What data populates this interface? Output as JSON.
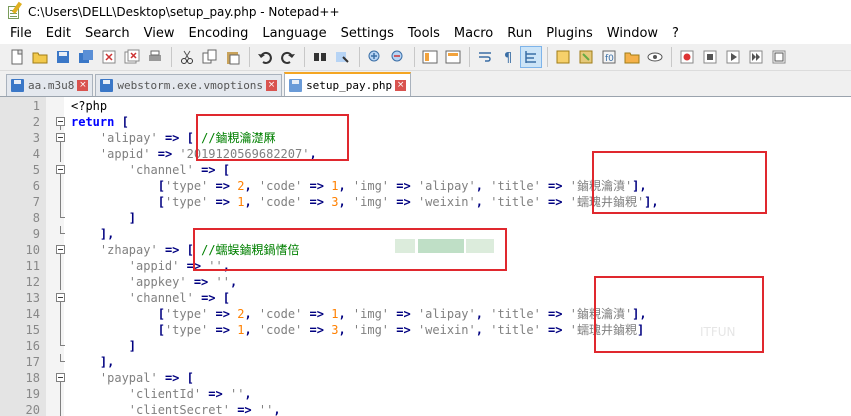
{
  "window": {
    "title": "C:\\Users\\DELL\\Desktop\\setup_pay.php - Notepad++",
    "app_icon": "notepad-plus-plus-icon"
  },
  "menu": [
    "File",
    "Edit",
    "Search",
    "View",
    "Encoding",
    "Language",
    "Settings",
    "Tools",
    "Macro",
    "Run",
    "Plugins",
    "Window",
    "?"
  ],
  "toolbar": {
    "buttons": [
      "new-file-icon",
      "open-file-icon",
      "save-icon",
      "save-all-icon",
      "close-icon",
      "close-all-icon",
      "print-icon",
      "cut-icon",
      "copy-icon",
      "paste-icon",
      "undo-icon",
      "redo-icon",
      "find-icon",
      "replace-icon",
      "zoom-in-icon",
      "zoom-out-icon",
      "sync-vertical-icon",
      "sync-horizontal-icon",
      "word-wrap-icon",
      "show-all-chars-icon",
      "indent-guide-icon",
      "user-lang-icon",
      "doc-map-icon",
      "function-list-icon",
      "folder-workspace-icon",
      "monitor-icon",
      "record-macro-icon",
      "stop-record-icon",
      "play-macro-icon",
      "run-macro-multiple-icon",
      "save-macro-icon"
    ]
  },
  "tabs": [
    {
      "label": "aa.m3u8",
      "active": false
    },
    {
      "label": "webstorm.exe.vmoptions",
      "active": false
    },
    {
      "label": "setup_pay.php",
      "active": true
    }
  ],
  "editor": {
    "lines": [
      {
        "n": "1",
        "fold": "",
        "tokens": [
          {
            "t": "php",
            "v": "<?php"
          }
        ]
      },
      {
        "n": "2",
        "fold": "box",
        "tokens": [
          {
            "t": "kw",
            "v": "return"
          },
          {
            "t": "php",
            "v": " "
          },
          {
            "t": "op",
            "v": "["
          }
        ]
      },
      {
        "n": "3",
        "fold": "box",
        "tokens": [
          {
            "t": "php",
            "v": "    "
          },
          {
            "t": "str",
            "v": "'alipay'"
          },
          {
            "t": "php",
            "v": " "
          },
          {
            "t": "op",
            "v": "=>"
          },
          {
            "t": "php",
            "v": " "
          },
          {
            "t": "op",
            "v": "["
          },
          {
            "t": "php",
            "v": " "
          },
          {
            "t": "cmt",
            "v": "//鏀粯瀹濋厤"
          }
        ]
      },
      {
        "n": "4",
        "fold": "line",
        "tokens": [
          {
            "t": "php",
            "v": "    "
          },
          {
            "t": "str",
            "v": "'appid'"
          },
          {
            "t": "php",
            "v": " "
          },
          {
            "t": "op",
            "v": "=>"
          },
          {
            "t": "php",
            "v": " "
          },
          {
            "t": "str",
            "v": "'2019120569682207'"
          },
          {
            "t": "op",
            "v": ","
          }
        ]
      },
      {
        "n": "5",
        "fold": "box",
        "tokens": [
          {
            "t": "php",
            "v": "        "
          },
          {
            "t": "str",
            "v": "'channel'"
          },
          {
            "t": "php",
            "v": " "
          },
          {
            "t": "op",
            "v": "=>"
          },
          {
            "t": "php",
            "v": " "
          },
          {
            "t": "op",
            "v": "["
          }
        ]
      },
      {
        "n": "6",
        "fold": "line",
        "tokens": [
          {
            "t": "php",
            "v": "            "
          },
          {
            "t": "op",
            "v": "["
          },
          {
            "t": "str",
            "v": "'type'"
          },
          {
            "t": "php",
            "v": " "
          },
          {
            "t": "op",
            "v": "=>"
          },
          {
            "t": "php",
            "v": " "
          },
          {
            "t": "num",
            "v": "2"
          },
          {
            "t": "op",
            "v": ","
          },
          {
            "t": "php",
            "v": " "
          },
          {
            "t": "str",
            "v": "'code'"
          },
          {
            "t": "php",
            "v": " "
          },
          {
            "t": "op",
            "v": "=>"
          },
          {
            "t": "php",
            "v": " "
          },
          {
            "t": "num",
            "v": "1"
          },
          {
            "t": "op",
            "v": ","
          },
          {
            "t": "php",
            "v": " "
          },
          {
            "t": "str",
            "v": "'img'"
          },
          {
            "t": "php",
            "v": " "
          },
          {
            "t": "op",
            "v": "=>"
          },
          {
            "t": "php",
            "v": " "
          },
          {
            "t": "str",
            "v": "'alipay'"
          },
          {
            "t": "op",
            "v": ","
          },
          {
            "t": "php",
            "v": " "
          },
          {
            "t": "str",
            "v": "'title'"
          },
          {
            "t": "php",
            "v": " "
          },
          {
            "t": "op",
            "v": "=>"
          },
          {
            "t": "php",
            "v": " "
          },
          {
            "t": "str",
            "v": "'鏀粯瀹濆'"
          },
          {
            "t": "op",
            "v": "],"
          }
        ]
      },
      {
        "n": "7",
        "fold": "line",
        "tokens": [
          {
            "t": "php",
            "v": "            "
          },
          {
            "t": "op",
            "v": "["
          },
          {
            "t": "str",
            "v": "'type'"
          },
          {
            "t": "php",
            "v": " "
          },
          {
            "t": "op",
            "v": "=>"
          },
          {
            "t": "php",
            "v": " "
          },
          {
            "t": "num",
            "v": "1"
          },
          {
            "t": "op",
            "v": ","
          },
          {
            "t": "php",
            "v": " "
          },
          {
            "t": "str",
            "v": "'code'"
          },
          {
            "t": "php",
            "v": " "
          },
          {
            "t": "op",
            "v": "=>"
          },
          {
            "t": "php",
            "v": " "
          },
          {
            "t": "num",
            "v": "3"
          },
          {
            "t": "op",
            "v": ","
          },
          {
            "t": "php",
            "v": " "
          },
          {
            "t": "str",
            "v": "'img'"
          },
          {
            "t": "php",
            "v": " "
          },
          {
            "t": "op",
            "v": "=>"
          },
          {
            "t": "php",
            "v": " "
          },
          {
            "t": "str",
            "v": "'weixin'"
          },
          {
            "t": "op",
            "v": ","
          },
          {
            "t": "php",
            "v": " "
          },
          {
            "t": "str",
            "v": "'title'"
          },
          {
            "t": "php",
            "v": " "
          },
          {
            "t": "op",
            "v": "=>"
          },
          {
            "t": "php",
            "v": " "
          },
          {
            "t": "str",
            "v": "'蠕瑰井鏀粯'"
          },
          {
            "t": "op",
            "v": "],"
          }
        ]
      },
      {
        "n": "8",
        "fold": "end",
        "tokens": [
          {
            "t": "php",
            "v": "        "
          },
          {
            "t": "op",
            "v": "]"
          }
        ]
      },
      {
        "n": "9",
        "fold": "end",
        "tokens": [
          {
            "t": "php",
            "v": "    "
          },
          {
            "t": "op",
            "v": "],"
          }
        ]
      },
      {
        "n": "10",
        "fold": "box",
        "tokens": [
          {
            "t": "php",
            "v": "    "
          },
          {
            "t": "str",
            "v": "'zhapay'"
          },
          {
            "t": "php",
            "v": " "
          },
          {
            "t": "op",
            "v": "=>"
          },
          {
            "t": "php",
            "v": " "
          },
          {
            "t": "op",
            "v": "["
          },
          {
            "t": "php",
            "v": " "
          },
          {
            "t": "cmt",
            "v": "//蠕蜈鏀粯鍋愭倍"
          }
        ]
      },
      {
        "n": "11",
        "fold": "line",
        "tokens": [
          {
            "t": "php",
            "v": "        "
          },
          {
            "t": "str",
            "v": "'appid'"
          },
          {
            "t": "php",
            "v": " "
          },
          {
            "t": "op",
            "v": "=>"
          },
          {
            "t": "php",
            "v": " "
          },
          {
            "t": "str",
            "v": "''"
          },
          {
            "t": "op",
            "v": ","
          }
        ]
      },
      {
        "n": "12",
        "fold": "line",
        "tokens": [
          {
            "t": "php",
            "v": "        "
          },
          {
            "t": "str",
            "v": "'appkey'"
          },
          {
            "t": "php",
            "v": " "
          },
          {
            "t": "op",
            "v": "=>"
          },
          {
            "t": "php",
            "v": " "
          },
          {
            "t": "str",
            "v": "''"
          },
          {
            "t": "op",
            "v": ","
          }
        ]
      },
      {
        "n": "13",
        "fold": "box",
        "tokens": [
          {
            "t": "php",
            "v": "        "
          },
          {
            "t": "str",
            "v": "'channel'"
          },
          {
            "t": "php",
            "v": " "
          },
          {
            "t": "op",
            "v": "=>"
          },
          {
            "t": "php",
            "v": " "
          },
          {
            "t": "op",
            "v": "["
          }
        ]
      },
      {
        "n": "14",
        "fold": "line",
        "tokens": [
          {
            "t": "php",
            "v": "            "
          },
          {
            "t": "op",
            "v": "["
          },
          {
            "t": "str",
            "v": "'type'"
          },
          {
            "t": "php",
            "v": " "
          },
          {
            "t": "op",
            "v": "=>"
          },
          {
            "t": "php",
            "v": " "
          },
          {
            "t": "num",
            "v": "2"
          },
          {
            "t": "op",
            "v": ","
          },
          {
            "t": "php",
            "v": " "
          },
          {
            "t": "str",
            "v": "'code'"
          },
          {
            "t": "php",
            "v": " "
          },
          {
            "t": "op",
            "v": "=>"
          },
          {
            "t": "php",
            "v": " "
          },
          {
            "t": "num",
            "v": "1"
          },
          {
            "t": "op",
            "v": ","
          },
          {
            "t": "php",
            "v": " "
          },
          {
            "t": "str",
            "v": "'img'"
          },
          {
            "t": "php",
            "v": " "
          },
          {
            "t": "op",
            "v": "=>"
          },
          {
            "t": "php",
            "v": " "
          },
          {
            "t": "str",
            "v": "'alipay'"
          },
          {
            "t": "op",
            "v": ","
          },
          {
            "t": "php",
            "v": " "
          },
          {
            "t": "str",
            "v": "'title'"
          },
          {
            "t": "php",
            "v": " "
          },
          {
            "t": "op",
            "v": "=>"
          },
          {
            "t": "php",
            "v": " "
          },
          {
            "t": "str",
            "v": "'鏀粯瀹濆'"
          },
          {
            "t": "op",
            "v": "],"
          }
        ]
      },
      {
        "n": "15",
        "fold": "line",
        "tokens": [
          {
            "t": "php",
            "v": "            "
          },
          {
            "t": "op",
            "v": "["
          },
          {
            "t": "str",
            "v": "'type'"
          },
          {
            "t": "php",
            "v": " "
          },
          {
            "t": "op",
            "v": "=>"
          },
          {
            "t": "php",
            "v": " "
          },
          {
            "t": "num",
            "v": "1"
          },
          {
            "t": "op",
            "v": ","
          },
          {
            "t": "php",
            "v": " "
          },
          {
            "t": "str",
            "v": "'code'"
          },
          {
            "t": "php",
            "v": " "
          },
          {
            "t": "op",
            "v": "=>"
          },
          {
            "t": "php",
            "v": " "
          },
          {
            "t": "num",
            "v": "3"
          },
          {
            "t": "op",
            "v": ","
          },
          {
            "t": "php",
            "v": " "
          },
          {
            "t": "str",
            "v": "'img'"
          },
          {
            "t": "php",
            "v": " "
          },
          {
            "t": "op",
            "v": "=>"
          },
          {
            "t": "php",
            "v": " "
          },
          {
            "t": "str",
            "v": "'weixin'"
          },
          {
            "t": "op",
            "v": ","
          },
          {
            "t": "php",
            "v": " "
          },
          {
            "t": "str",
            "v": "'title'"
          },
          {
            "t": "php",
            "v": " "
          },
          {
            "t": "op",
            "v": "=>"
          },
          {
            "t": "php",
            "v": " "
          },
          {
            "t": "str",
            "v": "'蠕瑰井鏀粯"
          },
          {
            "t": "op",
            "v": "]"
          }
        ]
      },
      {
        "n": "16",
        "fold": "end",
        "tokens": [
          {
            "t": "php",
            "v": "        "
          },
          {
            "t": "op",
            "v": "]"
          }
        ]
      },
      {
        "n": "17",
        "fold": "end",
        "tokens": [
          {
            "t": "php",
            "v": "    "
          },
          {
            "t": "op",
            "v": "],"
          }
        ]
      },
      {
        "n": "18",
        "fold": "box",
        "tokens": [
          {
            "t": "php",
            "v": "    "
          },
          {
            "t": "str",
            "v": "'paypal'"
          },
          {
            "t": "php",
            "v": " "
          },
          {
            "t": "op",
            "v": "=>"
          },
          {
            "t": "php",
            "v": " "
          },
          {
            "t": "op",
            "v": "["
          }
        ]
      },
      {
        "n": "19",
        "fold": "line",
        "tokens": [
          {
            "t": "php",
            "v": "        "
          },
          {
            "t": "str",
            "v": "'clientId'"
          },
          {
            "t": "php",
            "v": " "
          },
          {
            "t": "op",
            "v": "=>"
          },
          {
            "t": "php",
            "v": " "
          },
          {
            "t": "str",
            "v": "''"
          },
          {
            "t": "op",
            "v": ","
          }
        ]
      },
      {
        "n": "20",
        "fold": "line",
        "tokens": [
          {
            "t": "php",
            "v": "        "
          },
          {
            "t": "str",
            "v": "'clientSecret'"
          },
          {
            "t": "php",
            "v": " "
          },
          {
            "t": "op",
            "v": "=>"
          },
          {
            "t": "php",
            "v": " "
          },
          {
            "t": "str",
            "v": "''"
          },
          {
            "t": "op",
            "v": ","
          }
        ]
      }
    ]
  },
  "watermark": "ITFUN",
  "colors": {
    "keyword": "#0000ff",
    "string": "#808080",
    "operator": "#000080",
    "number": "#ff8000",
    "comment": "#008000",
    "annotation_box": "#e0282e",
    "active_tab_accent": "#f4a623"
  }
}
